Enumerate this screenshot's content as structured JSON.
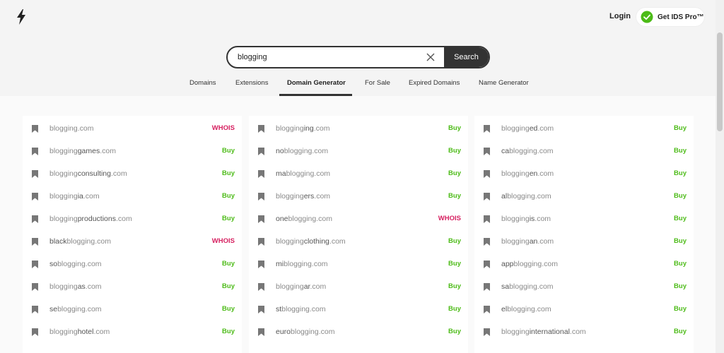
{
  "header": {
    "login_label": "Login",
    "pro_label": "Get IDS Pro™"
  },
  "search": {
    "value": "blogging",
    "button_label": "Search"
  },
  "tabs": [
    {
      "label": "Domains"
    },
    {
      "label": "Extensions"
    },
    {
      "label": "Domain Generator",
      "active": true
    },
    {
      "label": "For Sale"
    },
    {
      "label": "Expired Domains"
    },
    {
      "label": "Name Generator"
    }
  ],
  "colors": {
    "buy": "#4cbb17",
    "whois": "#d62060",
    "dark": "#333333"
  },
  "columns": [
    [
      {
        "pre": "",
        "kw": "blogging",
        "post": "",
        "tld": ".com",
        "action": "WHOIS"
      },
      {
        "pre": "",
        "kw": "blogging",
        "post": "games",
        "tld": ".com",
        "action": "Buy"
      },
      {
        "pre": "",
        "kw": "blogging",
        "post": "consulting",
        "tld": ".com",
        "action": "Buy"
      },
      {
        "pre": "",
        "kw": "blogging",
        "post": "ia",
        "tld": ".com",
        "action": "Buy"
      },
      {
        "pre": "",
        "kw": "blogging",
        "post": "productions",
        "tld": ".com",
        "action": "Buy"
      },
      {
        "pre": "black",
        "kw": "blogging",
        "post": "",
        "tld": ".com",
        "action": "WHOIS"
      },
      {
        "pre": "so",
        "kw": "blogging",
        "post": "",
        "tld": ".com",
        "action": "Buy"
      },
      {
        "pre": "",
        "kw": "blogging",
        "post": "as",
        "tld": ".com",
        "action": "Buy"
      },
      {
        "pre": "se",
        "kw": "blogging",
        "post": "",
        "tld": ".com",
        "action": "Buy"
      },
      {
        "pre": "",
        "kw": "blogging",
        "post": "hotel",
        "tld": ".com",
        "action": "Buy"
      }
    ],
    [
      {
        "pre": "",
        "kw": "blogging",
        "post": "ing",
        "tld": ".com",
        "action": "Buy"
      },
      {
        "pre": "no",
        "kw": "blogging",
        "post": "",
        "tld": ".com",
        "action": "Buy"
      },
      {
        "pre": "ma",
        "kw": "blogging",
        "post": "",
        "tld": ".com",
        "action": "Buy"
      },
      {
        "pre": "",
        "kw": "blogging",
        "post": "ers",
        "tld": ".com",
        "action": "Buy"
      },
      {
        "pre": "one",
        "kw": "blogging",
        "post": "",
        "tld": ".com",
        "action": "WHOIS"
      },
      {
        "pre": "",
        "kw": "blogging",
        "post": "clothing",
        "tld": ".com",
        "action": "Buy"
      },
      {
        "pre": "mi",
        "kw": "blogging",
        "post": "",
        "tld": ".com",
        "action": "Buy"
      },
      {
        "pre": "",
        "kw": "blogging",
        "post": "ar",
        "tld": ".com",
        "action": "Buy"
      },
      {
        "pre": "st",
        "kw": "blogging",
        "post": "",
        "tld": ".com",
        "action": "Buy"
      },
      {
        "pre": "euro",
        "kw": "blogging",
        "post": "",
        "tld": ".com",
        "action": "Buy"
      }
    ],
    [
      {
        "pre": "",
        "kw": "blogging",
        "post": "ed",
        "tld": ".com",
        "action": "Buy"
      },
      {
        "pre": "ca",
        "kw": "blogging",
        "post": "",
        "tld": ".com",
        "action": "Buy"
      },
      {
        "pre": "",
        "kw": "blogging",
        "post": "en",
        "tld": ".com",
        "action": "Buy"
      },
      {
        "pre": "al",
        "kw": "blogging",
        "post": "",
        "tld": ".com",
        "action": "Buy"
      },
      {
        "pre": "",
        "kw": "blogging",
        "post": "is",
        "tld": ".com",
        "action": "Buy"
      },
      {
        "pre": "",
        "kw": "blogging",
        "post": "an",
        "tld": ".com",
        "action": "Buy"
      },
      {
        "pre": "app",
        "kw": "blogging",
        "post": "",
        "tld": ".com",
        "action": "Buy"
      },
      {
        "pre": "sa",
        "kw": "blogging",
        "post": "",
        "tld": ".com",
        "action": "Buy"
      },
      {
        "pre": "el",
        "kw": "blogging",
        "post": "",
        "tld": ".com",
        "action": "Buy"
      },
      {
        "pre": "",
        "kw": "blogging",
        "post": "international",
        "tld": ".com",
        "action": "Buy"
      }
    ]
  ]
}
